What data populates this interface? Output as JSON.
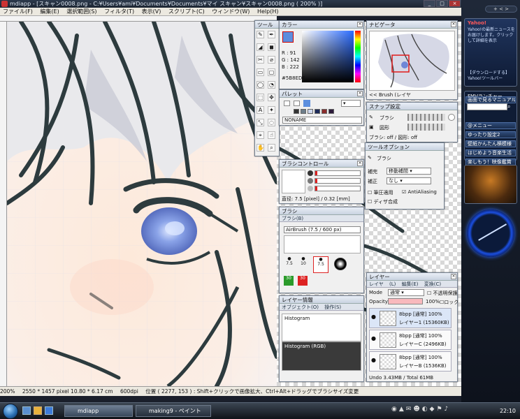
{
  "window": {
    "title": "mdiapp - [スキャン0008.png - C:¥Users¥ami¥Documents¥Documents¥マイ スキャン¥スキャン0008.png ( 200% )]",
    "controls": [
      "_",
      "□",
      "×"
    ]
  },
  "menu": [
    "ファイル(F)",
    "編集(E)",
    "選択範囲(S)",
    "フィルタ(T)",
    "表示(V)",
    "スクリプト(C)",
    "ウィンドウ(W)",
    "Help(H)"
  ],
  "status": {
    "zoom": "200%",
    "size": "2550 * 1457 pixel  10.80 * 6.17 cm",
    "dpi": "600dpi",
    "hint": "位置 ( 2277, 153 ) : Shift+クリックで画像拡大、Ctrl+Alt+ドラッグでブラシサイズ変更"
  },
  "panels": {
    "tool": {
      "title": "ツール",
      "icons": [
        "✎",
        "✒",
        "◢",
        "◼",
        "✂",
        "⌀",
        "▭",
        "▢",
        "◯",
        "◔",
        "⬚",
        "✥",
        "A",
        "✦",
        "⤡",
        "◌",
        "⌖",
        "☝",
        "✋",
        "⌕"
      ]
    },
    "color": {
      "title": "カラー",
      "r": "R : 91",
      "g": "G : 142",
      "b": "B : 222",
      "hex": "#5B8EDE",
      "accent": "#5b8ede"
    },
    "palette": {
      "title": "パレット",
      "name": "NONAME"
    },
    "navigator": {
      "title": "ナビゲータ",
      "label": "<< Brush (レイヤ"
    },
    "snap": {
      "title": "スナップ設定",
      "brush": "ブラシ",
      "shape": "図形",
      "status": "ブラシ: off / 図形: off"
    },
    "toolopt": {
      "title": "ツールオプション",
      "tool": "ブラシ",
      "mode_label": "補完",
      "mode_value": "移動補間",
      "correct_label": "補正",
      "correct_value": "なし",
      "chk1": "筆圧適用",
      "chk2": "AntiAliasing",
      "chk3": "ディザ合成"
    },
    "brushctl": {
      "title": "ブラシコントロール",
      "readout": "直径: 7.5 [pixel] / 0.32 [mm]"
    },
    "brush": {
      "title": "ブラシ",
      "tab": "ブラシ(B)",
      "current": "AirBrush (7.5 / 600 px)",
      "sizes": [
        "7.5",
        "10",
        "7.5",
        "",
        "30",
        "30"
      ]
    },
    "layerinfo": {
      "title": "レイヤー情報",
      "tabs": [
        "オブジェクト(O)",
        "操作(S)"
      ],
      "histogram": "Histogram",
      "histogram_rgb": "Histogram (RGB)"
    },
    "layer": {
      "title": "レイヤー",
      "tabs": [
        "レイヤ",
        "(L)",
        "編集(E)",
        "変換(C)"
      ],
      "mode_label": "Mode",
      "mode_value": "通常",
      "opacity_label": "Opacity",
      "opacity_value": "100%",
      "keep_alpha": "不透明保護",
      "lock": "ロック",
      "rows": [
        {
          "info": "8bpp [通常] 100%",
          "name": "レイヤー1 (15360KB)"
        },
        {
          "info": "8bpp [通常] 100%",
          "name": "レイヤーC (2496KB)"
        },
        {
          "info": "8bpp [通常] 100%",
          "name": "レイヤーB (1536KB)"
        }
      ],
      "memory": "Undo 3.43MB / Total 61MB"
    }
  },
  "sidebar": {
    "header_icons": [
      "+",
      "<",
      ">"
    ],
    "news_brand": "Yahoo!",
    "news_text": "Yahoo!の最新ニュースをお届けします。クリックして詳細を表示",
    "news_link": "【ダウンロードする】 Yahoo!ツールバー",
    "fmv_title": "FMVランチャー",
    "fmv_items": [
      "画面で見るマニュアル",
      "@メニュー",
      "ゆったり設定2",
      "壁紙かんたん横模様",
      "はじめよう音楽生活",
      "楽しもう！映像鑑賞"
    ]
  },
  "taskbar": {
    "items": [
      "mdiapp",
      "making9 - ペイント"
    ],
    "clock": "22:10"
  }
}
